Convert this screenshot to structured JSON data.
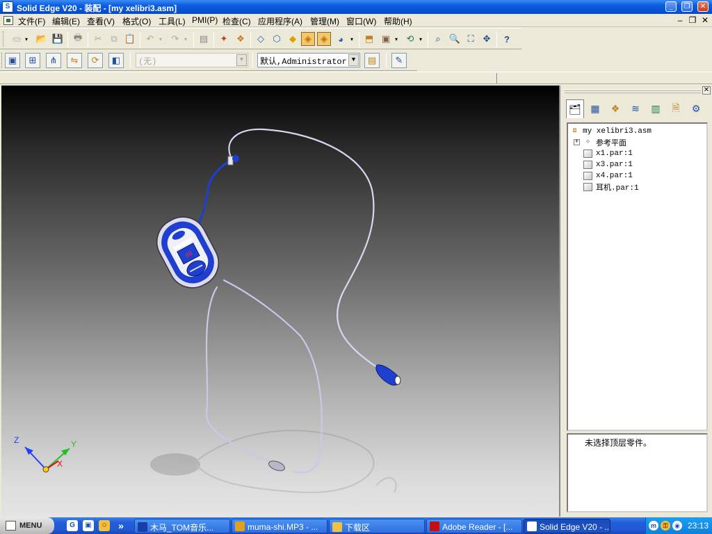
{
  "window": {
    "title": "Solid Edge V20 - 装配 - [my xelibri3.asm]",
    "app_icon_label": "S",
    "min_label": "_",
    "max_label": "❐",
    "close_label": "✕"
  },
  "menubar": {
    "items": [
      "文件(F)",
      "编辑(E)",
      "查看(V)",
      "格式(O)",
      "工具(L)",
      "PMI(P)",
      "检查(C)",
      "应用程序(A)",
      "管理(M)",
      "窗口(W)",
      "帮助(H)"
    ],
    "doc_min": "–",
    "doc_restore": "❐",
    "doc_close": "✕"
  },
  "toolbar_row2": {
    "layer_combo_value": "(无)",
    "config_combo_value": "默认,Administrator"
  },
  "pathfinder": {
    "close_label": "✕",
    "tree": {
      "root": "my xelibri3.asm",
      "expander": "+",
      "ref_planes": "参考平面",
      "parts": [
        "x1.par:1",
        "x3.par:1",
        "x4.par:1",
        "耳机.par:1"
      ]
    },
    "status": "未选择顶层零件。"
  },
  "viewport": {
    "axes": {
      "x": "X",
      "y": "Y",
      "z": "Z"
    },
    "colors": {
      "device_blue": "#1e3fd0",
      "cable": "#d8d8f0",
      "axis_z": "#1e40ff",
      "axis_y": "#20c020",
      "axis_x": "#e01010"
    }
  },
  "taskbar": {
    "start_label": "MENU",
    "more_label": "»",
    "tasks": [
      {
        "label": "木马_TOM音乐...",
        "icon_color": "#1a3ea8"
      },
      {
        "label": "muma-shi.MP3 - ...",
        "icon_color": "#e0a020"
      },
      {
        "label": "下载区",
        "icon_color": "#f0c040"
      },
      {
        "label": "Adobe Reader - [...",
        "icon_color": "#c01010"
      },
      {
        "label": "Solid Edge V20 - ...",
        "icon_color": "#ffffff"
      }
    ],
    "clock": "23:13"
  }
}
